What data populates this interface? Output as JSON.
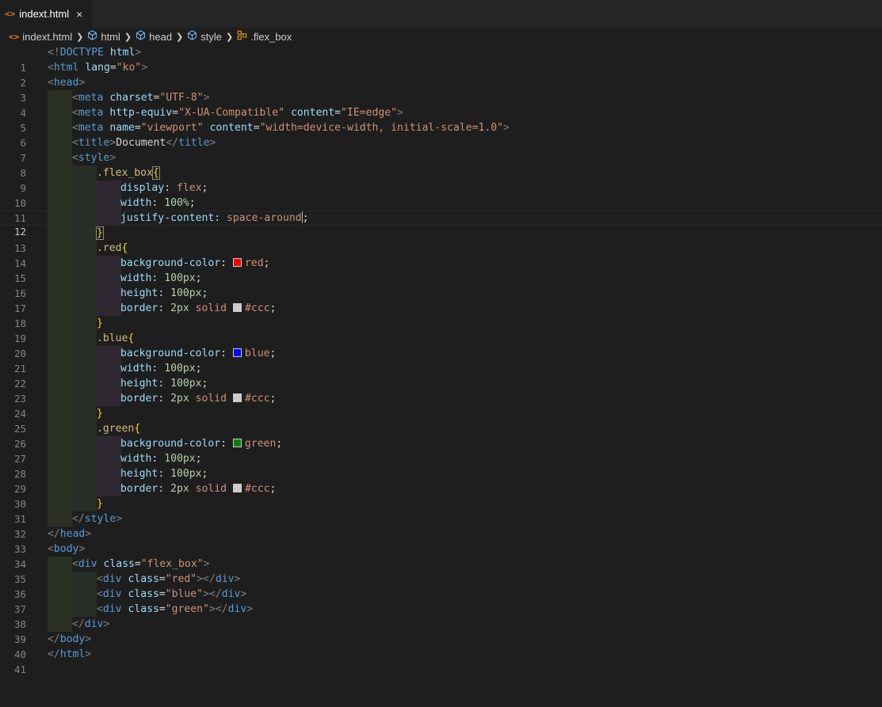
{
  "tab": {
    "icon": "html-file-icon",
    "label": "indext.html",
    "close": "×"
  },
  "breadcrumb": [
    {
      "label": "indext.html",
      "icon": "html-file-icon"
    },
    {
      "label": "html",
      "icon": "element-cube-icon"
    },
    {
      "label": "head",
      "icon": "element-cube-icon"
    },
    {
      "label": "style",
      "icon": "element-cube-icon"
    },
    {
      "label": ".flex_box",
      "icon": "css-class-icon"
    }
  ],
  "current_line": 12,
  "swatch_colors": {
    "red": "#ff0000",
    "blue": "#0000ff",
    "green": "#008000",
    "ccc": "#cccccc"
  },
  "lines": [
    {
      "n": "1",
      "t": [
        "<!",
        "DOCTYPE",
        " ",
        "html",
        ">"
      ]
    },
    {
      "n": "2",
      "t": [
        "<",
        "html",
        " ",
        "lang",
        "=",
        "\"ko\"",
        ">"
      ]
    },
    {
      "n": "3",
      "t": [
        "<",
        "head",
        ">"
      ]
    },
    {
      "n": "4",
      "t": [
        "<",
        "meta",
        " ",
        "charset",
        "=",
        "\"UTF-8\"",
        ">"
      ]
    },
    {
      "n": "5",
      "t": [
        "<",
        "meta",
        " ",
        "http-equiv",
        "=",
        "\"X-UA-Compatible\"",
        " ",
        "content",
        "=",
        "\"IE=edge\"",
        ">"
      ]
    },
    {
      "n": "6",
      "t": [
        "<",
        "meta",
        " ",
        "name",
        "=",
        "\"viewport\"",
        " ",
        "content",
        "=",
        "\"width=device-width, initial-scale=1.0\"",
        ">"
      ]
    },
    {
      "n": "7",
      "t": [
        "<",
        "title",
        ">",
        "Document",
        "</",
        "title",
        ">"
      ]
    },
    {
      "n": "8",
      "t": [
        "<",
        "style",
        ">"
      ]
    },
    {
      "n": "9",
      "t": [
        ".flex_box",
        "{"
      ]
    },
    {
      "n": "10",
      "t": [
        "display",
        ": ",
        "flex",
        ";"
      ]
    },
    {
      "n": "11",
      "t": [
        "width",
        ": ",
        "100%",
        ";"
      ]
    },
    {
      "n": "12",
      "t": [
        "justify-content",
        ": ",
        "space-around",
        ";"
      ]
    },
    {
      "n": "13",
      "t": [
        "}"
      ]
    },
    {
      "n": "14",
      "t": [
        ".red",
        "{"
      ]
    },
    {
      "n": "15",
      "t": [
        "background-color",
        ": ",
        "red",
        ";"
      ]
    },
    {
      "n": "16",
      "t": [
        "width",
        ": ",
        "100px",
        ";"
      ]
    },
    {
      "n": "17",
      "t": [
        "height",
        ": ",
        "100px",
        ";"
      ]
    },
    {
      "n": "18",
      "t": [
        "border",
        ": ",
        "2px",
        " ",
        "solid",
        " ",
        "#ccc",
        ";"
      ]
    },
    {
      "n": "19",
      "t": [
        "}"
      ]
    },
    {
      "n": "20",
      "t": [
        ".blue",
        "{"
      ]
    },
    {
      "n": "21",
      "t": [
        "background-color",
        ": ",
        "blue",
        ";"
      ]
    },
    {
      "n": "22",
      "t": [
        "width",
        ": ",
        "100px",
        ";"
      ]
    },
    {
      "n": "23",
      "t": [
        "height",
        ": ",
        "100px",
        ";"
      ]
    },
    {
      "n": "24",
      "t": [
        "border",
        ": ",
        "2px",
        " ",
        "solid",
        " ",
        "#ccc",
        ";"
      ]
    },
    {
      "n": "25",
      "t": [
        "}"
      ]
    },
    {
      "n": "26",
      "t": [
        ".green",
        "{"
      ]
    },
    {
      "n": "27",
      "t": [
        "background-color",
        ": ",
        "green",
        ";"
      ]
    },
    {
      "n": "28",
      "t": [
        "width",
        ": ",
        "100px",
        ";"
      ]
    },
    {
      "n": "29",
      "t": [
        "height",
        ": ",
        "100px",
        ";"
      ]
    },
    {
      "n": "30",
      "t": [
        "border",
        ": ",
        "2px",
        " ",
        "solid",
        " ",
        "#ccc",
        ";"
      ]
    },
    {
      "n": "31",
      "t": [
        "}"
      ]
    },
    {
      "n": "32",
      "t": [
        "</",
        "style",
        ">"
      ]
    },
    {
      "n": "33",
      "t": [
        "</",
        "head",
        ">"
      ]
    },
    {
      "n": "34",
      "t": [
        "<",
        "body",
        ">"
      ]
    },
    {
      "n": "35",
      "t": [
        "<",
        "div",
        " ",
        "class",
        "=",
        "\"flex_box\"",
        ">"
      ]
    },
    {
      "n": "36",
      "t": [
        "<",
        "div",
        " ",
        "class",
        "=",
        "\"red\"",
        "></",
        "div",
        ">"
      ]
    },
    {
      "n": "37",
      "t": [
        "<",
        "div",
        " ",
        "class",
        "=",
        "\"blue\"",
        "></",
        "div",
        ">"
      ]
    },
    {
      "n": "38",
      "t": [
        "<",
        "div",
        " ",
        "class",
        "=",
        "\"green\"",
        "></",
        "div",
        ">"
      ]
    },
    {
      "n": "39",
      "t": [
        "</",
        "div",
        ">"
      ]
    },
    {
      "n": "40",
      "t": [
        "</",
        "body",
        ">"
      ]
    },
    {
      "n": "41",
      "t": [
        "</",
        "html",
        ">"
      ]
    }
  ]
}
